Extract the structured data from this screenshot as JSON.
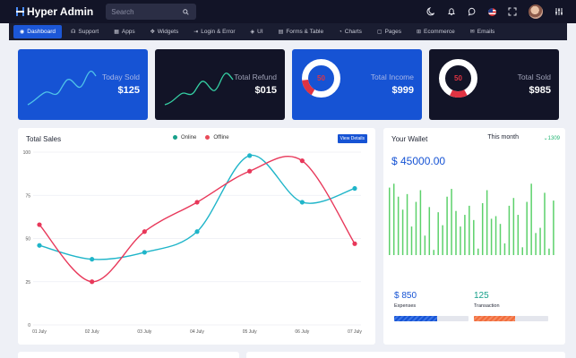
{
  "app": {
    "title": "Hyper Admin"
  },
  "search": {
    "placeholder": "Search"
  },
  "topbar": {
    "icons": [
      "moon-icon",
      "bell-icon",
      "chat-icon",
      "flag-icon",
      "fullscreen-icon",
      "avatar",
      "settings-icon"
    ]
  },
  "nav": {
    "items": [
      {
        "label": "Dashboard",
        "icon": "dashboard-icon",
        "active": true
      },
      {
        "label": "Support",
        "icon": "headset-icon"
      },
      {
        "label": "Apps",
        "icon": "apps-icon"
      },
      {
        "label": "Widgets",
        "icon": "widgets-icon"
      },
      {
        "label": "Login & Error",
        "icon": "login-icon"
      },
      {
        "label": "UI",
        "icon": "ui-icon"
      },
      {
        "label": "Forms & Table",
        "icon": "forms-icon"
      },
      {
        "label": "Charts",
        "icon": "charts-icon"
      },
      {
        "label": "Pages",
        "icon": "pages-icon"
      },
      {
        "label": "Ecommerce",
        "icon": "cart-icon"
      },
      {
        "label": "Emails",
        "icon": "mail-icon"
      }
    ]
  },
  "stats": [
    {
      "label": "Today Sold",
      "value": "$125",
      "kind": "sparkline",
      "theme": "blue",
      "color": "#4fc3e8"
    },
    {
      "label": "Total Refund",
      "value": "$015",
      "kind": "sparkline",
      "theme": "dark",
      "color": "#35d0a4"
    },
    {
      "label": "Total Income",
      "value": "$999",
      "kind": "ring",
      "theme": "blue",
      "ring_text": "50",
      "ring_fraction": 0.15
    },
    {
      "label": "Total Sold",
      "value": "$985",
      "kind": "ring",
      "theme": "dark",
      "ring_text": "50",
      "ring_fraction": 0.15
    }
  ],
  "sales": {
    "title": "Total Sales",
    "view_button": "View Details",
    "legend": [
      {
        "name": "Online",
        "color": "#16a08a"
      },
      {
        "name": "Offline",
        "color": "#e94b59"
      }
    ]
  },
  "chart_data": {
    "type": "line",
    "categories": [
      "01 July",
      "02 July",
      "03 July",
      "04 July",
      "05 July",
      "06 July",
      "07 July"
    ],
    "series": [
      {
        "name": "Online",
        "color": "#1fb5c9",
        "values": [
          46,
          38,
          42,
          54,
          98,
          71,
          79
        ]
      },
      {
        "name": "Offline",
        "color": "#e8385a",
        "values": [
          58,
          25,
          54,
          71,
          89,
          95,
          47
        ]
      }
    ],
    "y_ticks": [
      "0",
      "25",
      "50",
      "75",
      "100"
    ],
    "ylim": [
      0,
      100
    ]
  },
  "wallet": {
    "title": "Your Wallet",
    "period": "This month",
    "change": "1309",
    "amount": "$ 45000.00",
    "bar_color": "#5cd16b",
    "bars": [
      0.52,
      0.55,
      0.45,
      0.35,
      0.47,
      0.22,
      0.41,
      0.5,
      0.15,
      0.37,
      0.04,
      0.33,
      0.23,
      0.45,
      0.51,
      0.34,
      0.22,
      0.31,
      0.38,
      0.27,
      0.05,
      0.4,
      0.5,
      0.28,
      0.3,
      0.24,
      0.09,
      0.38,
      0.44,
      0.31,
      0.06,
      0.41,
      0.55,
      0.17,
      0.21,
      0.48,
      0.05,
      0.42
    ],
    "expenses": {
      "value": "$ 850",
      "label": "Expenses",
      "color": "#1653d4",
      "progress": 0.58
    },
    "transaction": {
      "value": "125",
      "label": "Transaction",
      "color": "#f26b3a",
      "progress": 0.55
    }
  }
}
